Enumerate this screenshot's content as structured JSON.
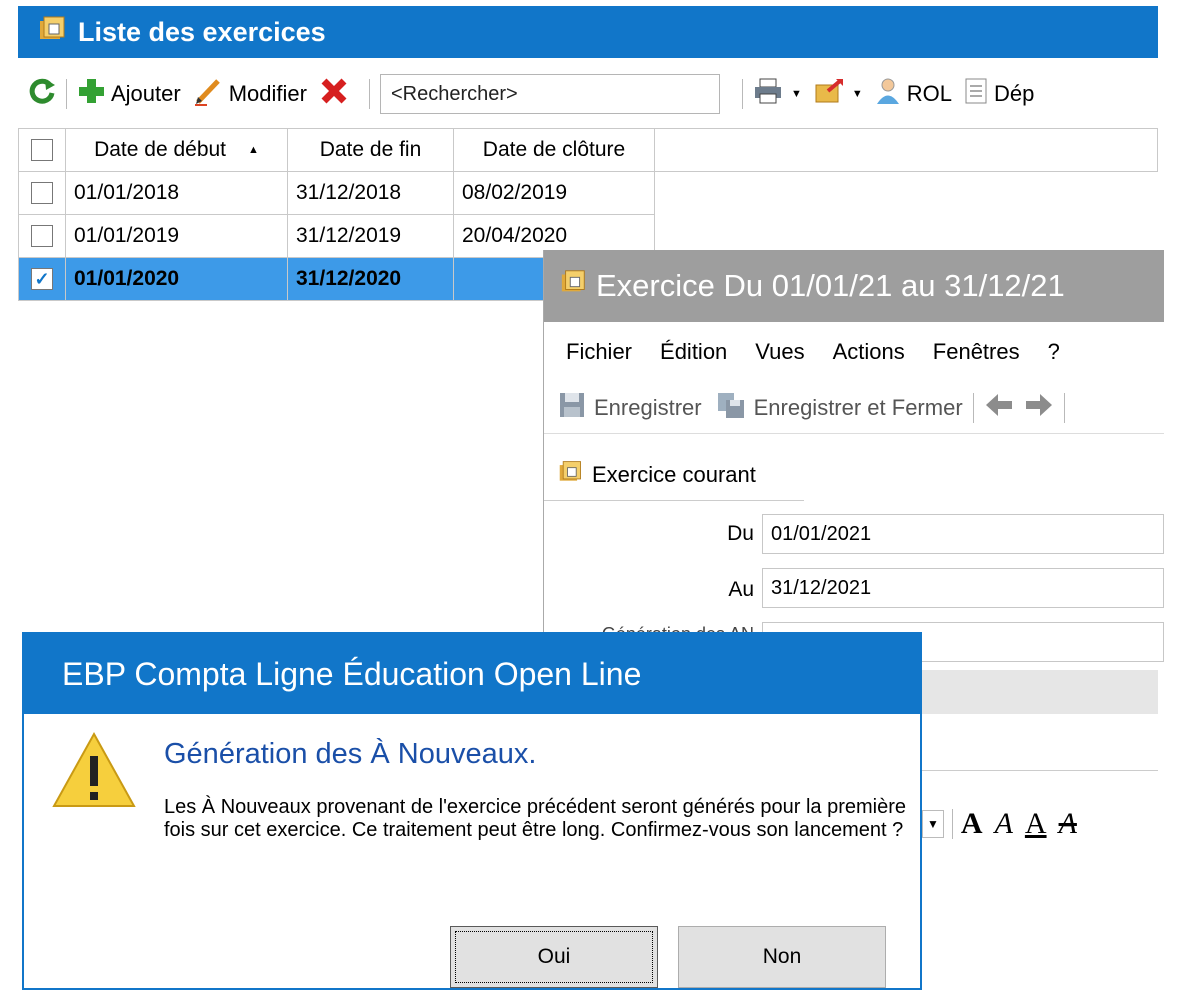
{
  "list_window": {
    "title": "Liste des exercices",
    "toolbar": {
      "add_label": "Ajouter",
      "edit_label": "Modifier",
      "search_placeholder": "<Rechercher>",
      "rol_label": "ROL",
      "truncated_label": "Dép"
    },
    "grid": {
      "columns": [
        "Date de début",
        "Date de fin",
        "Date de clôture"
      ],
      "rows": [
        {
          "start": "01/01/2018",
          "end": "31/12/2018",
          "closed": "08/02/2019",
          "checked": false
        },
        {
          "start": "01/01/2019",
          "end": "31/12/2019",
          "closed": "20/04/2020",
          "checked": false
        },
        {
          "start": "01/01/2020",
          "end": "31/12/2020",
          "closed": "",
          "checked": true
        }
      ]
    }
  },
  "exercise_window": {
    "title": "Exercice Du 01/01/21 au 31/12/21",
    "menu": [
      "Fichier",
      "Édition",
      "Vues",
      "Actions",
      "Fenêtres",
      "?"
    ],
    "toolbar": {
      "save_label": "Enregistrer",
      "save_close_label": "Enregistrer et Fermer"
    },
    "tab_label": "Exercice courant",
    "form": {
      "du_label": "Du",
      "du_value": "01/01/2021",
      "au_label": "Au",
      "au_value": "31/12/2021",
      "partial_label": "Génération des AN"
    }
  },
  "dialog": {
    "title": "EBP Compta Ligne Éducation Open Line",
    "heading": "Génération des À Nouveaux.",
    "message": "Les À Nouveaux provenant de l'exercice précédent seront générés pour la première fois sur cet exercice. Ce traitement peut être long. Confirmez-vous son lancement ?",
    "yes_label": "Oui",
    "no_label": "Non"
  },
  "colors": {
    "title_blue": "#1176c9",
    "selection_blue": "#3d9ae8",
    "inactive_title_grey": "#9e9e9e",
    "heading_blue": "#1a4fa8"
  }
}
